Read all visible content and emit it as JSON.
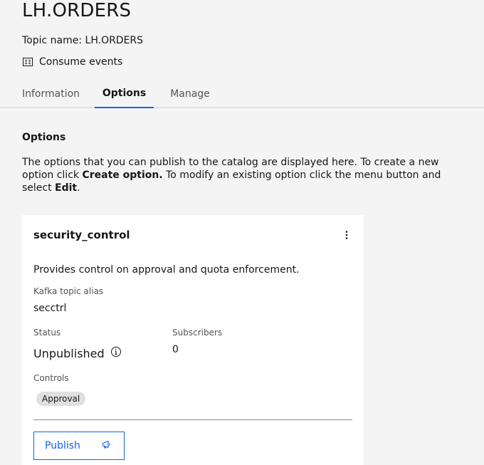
{
  "header": {
    "title": "LH.ORDERS",
    "topic_name": "Topic name: LH.ORDERS",
    "consume_label": "Consume events",
    "consume_icon": "events-list-icon"
  },
  "tabs": [
    {
      "label": "Information",
      "active": false
    },
    {
      "label": "Options",
      "active": true
    },
    {
      "label": "Manage",
      "active": false
    }
  ],
  "options_section": {
    "title": "Options",
    "description_part1": "The options that you can publish to the catalog are displayed here. To create a new option click ",
    "create_label": "Create option.",
    "description_part2": " To modify an existing option click the menu button and select ",
    "edit_label": "Edit",
    "description_end": "."
  },
  "card": {
    "title": "security_control",
    "description": "Provides control on approval and quota enforcement.",
    "alias_label": "Kafka topic alias",
    "alias_value": "secctrl",
    "status_label": "Status",
    "status_value": "Unpublished",
    "subscribers_label": "Subscribers",
    "subscribers_value": "0",
    "controls_label": "Controls",
    "controls": [
      "Approval"
    ],
    "publish_label": "Publish",
    "publish_icon": "megaphone-icon"
  },
  "colors": {
    "accent": "#0f62fe",
    "background": "#f4f4f4",
    "card": "#ffffff"
  }
}
